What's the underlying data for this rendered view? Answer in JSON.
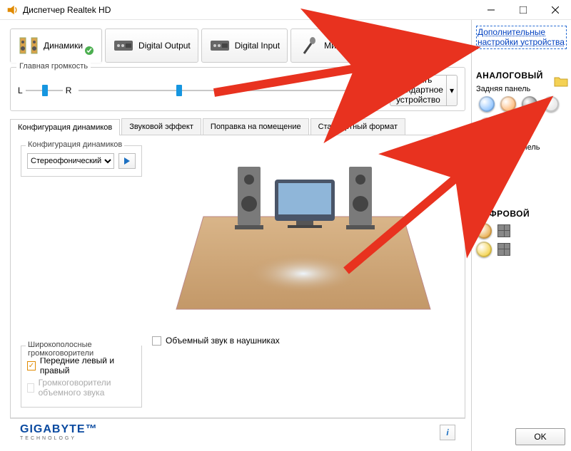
{
  "window": {
    "title": "Диспетчер Realtek HD"
  },
  "device_tabs": [
    {
      "label": "Динамики",
      "default_badge": true
    },
    {
      "label": "Digital Output"
    },
    {
      "label": "Digital Input"
    },
    {
      "label": "Микрофон"
    }
  ],
  "right_link": "Дополнительные настройки устройства",
  "main_volume": {
    "legend": "Главная громкость",
    "l": "L",
    "r": "R",
    "balance_pct": 45,
    "volume_pct": 35
  },
  "default_device": {
    "line1": "Задать",
    "line2": "стандартное",
    "line3": "устройство"
  },
  "config_tabs": [
    "Конфигурация динамиков",
    "Звуковой эффект",
    "Поправка на помещение",
    "Стандартный формат"
  ],
  "speaker_config": {
    "legend": "Конфигурация динамиков",
    "selected": "Стереофонический"
  },
  "fullrange": {
    "legend": "Широкополосные громкоговорители",
    "opt1": "Передние левый и правый",
    "opt1_checked": true,
    "opt2": "Громкоговорители объемного звука",
    "opt2_checked": false
  },
  "virtual_surround": {
    "label": "Объемный звук в наушниках",
    "checked": false
  },
  "analog": {
    "title": "АНАЛОГОВЫЙ",
    "back_label": "Задняя панель",
    "front_label": "Передняя панель"
  },
  "digital": {
    "title": "ЦИФРОВОЙ"
  },
  "jack_colors_back": [
    "#5aa7ff",
    "#ff9a3a",
    "#d9d9d9",
    "#ff5050",
    "#c9a2e2",
    "#3da63d"
  ],
  "jack_colors_front": [
    "#2fa52f",
    "#d36f8a"
  ],
  "jack_colors_digital": [
    "#e08a00",
    "#f0c000"
  ],
  "footer": {
    "ok": "OK"
  }
}
